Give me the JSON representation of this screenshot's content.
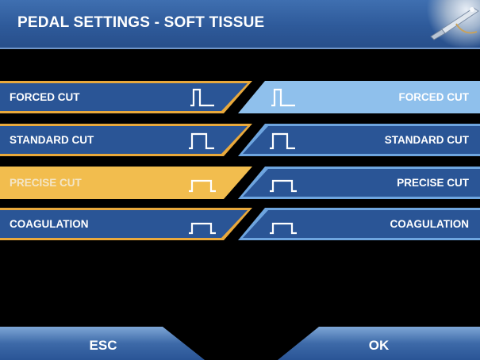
{
  "header": {
    "title": "PEDAL SETTINGS - SOFT TISSUE"
  },
  "modes": [
    {
      "left_label": "FORCED CUT",
      "right_label": "FORCED CUT"
    },
    {
      "left_label": "STANDARD CUT",
      "right_label": "STANDARD CUT"
    },
    {
      "left_label": "PRECISE CUT",
      "right_label": "PRECISE CUT"
    },
    {
      "left_label": "COAGULATION",
      "right_label": "COAGULATION"
    }
  ],
  "selection": {
    "left_pedal": "PRECISE CUT",
    "right_pedal": "FORCED CUT"
  },
  "footer": {
    "esc_label": "ESC",
    "ok_label": "OK"
  },
  "colors": {
    "header_blue": "#2e5a9a",
    "button_blue": "#2a5596",
    "selected_left": "#f2bd4e",
    "selected_right": "#8fc0ec",
    "outline_orange": "#e9a93c",
    "outline_blue": "#6ea5df"
  }
}
